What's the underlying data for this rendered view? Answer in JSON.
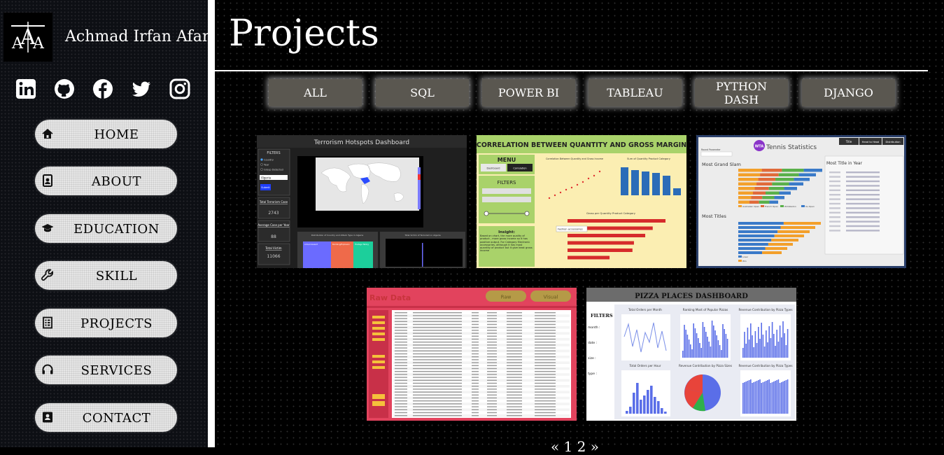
{
  "sidebar": {
    "logo_text": "AIA",
    "owner_name": "Achmad Irfan Afandi",
    "socials": [
      {
        "icon": "linkedin-icon"
      },
      {
        "icon": "github-icon"
      },
      {
        "icon": "facebook-icon"
      },
      {
        "icon": "twitter-icon"
      },
      {
        "icon": "instagram-icon"
      }
    ],
    "nav": [
      {
        "label": "HOME",
        "icon": "home-icon"
      },
      {
        "label": "ABOUT",
        "icon": "about-icon"
      },
      {
        "label": "EDUCATION",
        "icon": "graduation-cap-icon"
      },
      {
        "label": "SKILL",
        "icon": "wrench-icon"
      },
      {
        "label": "PROJECTS",
        "icon": "list-icon"
      },
      {
        "label": "SERVICES",
        "icon": "headset-icon"
      },
      {
        "label": "CONTACT",
        "icon": "contact-card-icon"
      }
    ]
  },
  "main": {
    "title": "Projects",
    "filters": [
      "ALL",
      "SQL",
      "POWER BI",
      "TABLEAU",
      "PYTHON DASH",
      "DJANGO"
    ],
    "projects": [
      {
        "title": "Terrorism Hotspots Dashboard",
        "filters_label": "FILTERS",
        "options": [
          "Country",
          "Year",
          "Group Detected"
        ],
        "country_value": "Algeria",
        "submit_label": "Submit",
        "total_cases_label": "Total Terrorism Case",
        "total_cases": "2743",
        "avg_label": "Average Case per Year",
        "avg_value": "88",
        "victims_label": "Total Victim",
        "victims_value": "11066",
        "chart1_title": "Distribution of Country and Attack Type in Algeria",
        "chart2_title": "Total Victim of Terrorism in Algeria",
        "legend": [
          "Armed Assault",
          "Bombing/Explosion",
          "Hostage Taking"
        ]
      },
      {
        "title": "CORRELATION BETWEEN QUANTITY AND GROSS MARGIN",
        "menu_label": "MENU",
        "menu_buttons": [
          "Dashboard",
          "Correlation"
        ],
        "filters_label": "FILTERS",
        "chart1_title": "Correlation Between Quantity and Gross Income",
        "chart2_title": "Sum of Quantity Product Category",
        "chart3_title": "Gross per Quantity Product Category",
        "tooltip": "Fashion accessories",
        "insight_label": "Insight:",
        "insight_text": "Based on chart, the more quality of product , more gross income so it has positive output. For Category Electronic accessories, although it has most quantity of product but it give least gross income",
        "bars": [
          2.61,
          2.27,
          2.07,
          1.77,
          1.73,
          1.12
        ]
      },
      {
        "title": "Tennis Statistics",
        "brand": "WTA",
        "tabs": [
          "Title",
          "Head to Head",
          "Distribution"
        ],
        "round_label": "Round Parameter",
        "section1": "Most Grand Slam",
        "section2": "Most Titles",
        "section3": "Most Title in Year",
        "legend": [
          "Australian Open",
          "French Open",
          "Wimbledon",
          "Us Open"
        ],
        "legend2": [
          "Loser",
          "Win"
        ],
        "players": [
          "Serena Williams",
          "Chris Evert",
          "Martina Navratilova",
          "Steffi Graf",
          "Margaret Court",
          "Venus Williams",
          "Billie Jean King",
          "Monica Seles"
        ]
      },
      {
        "title": "Raw Data",
        "buttons": [
          "Raw",
          "Visual"
        ]
      },
      {
        "title": "PIZZA PLACES DASHBOARD",
        "filters_label": "FILTERS",
        "filter_fields": [
          "month :",
          "date :",
          "size :",
          "type :"
        ],
        "charts": [
          "Total Orders per Month",
          "Ranking Most of Popular Pizzas",
          "Revenue Contribution by Pizza Types",
          "Total Orders per Hour",
          "Revenue Contribution by Pizza Sizes",
          "Revenue Contribution by Pizza Types"
        ]
      }
    ],
    "pager": "« 1 2 »"
  }
}
